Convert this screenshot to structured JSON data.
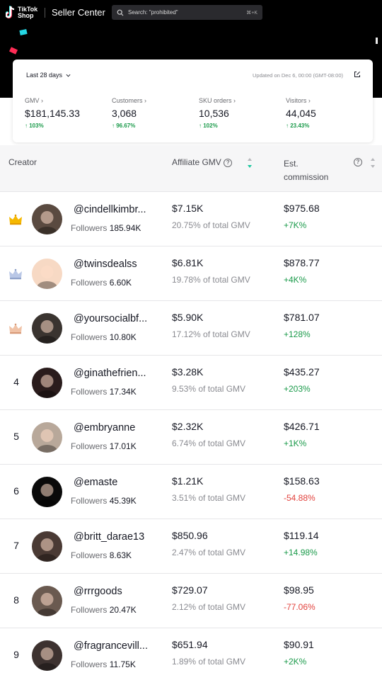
{
  "header": {
    "brand_line1": "TikTok",
    "brand_line2": "Shop",
    "app_title": "Seller Center",
    "search_placeholder": "Search: \"prohibited\"",
    "search_shortcut": "⌘+K"
  },
  "stats": {
    "period": "Last 28 days",
    "updated": "Updated on Dec 6, 00:00 (GMT-08:00)",
    "metrics": [
      {
        "label": "GMV ›",
        "value": "$181,145.33",
        "delta": "103%"
      },
      {
        "label": "Customers ›",
        "value": "3,068",
        "delta": "96.67%"
      },
      {
        "label": "SKU orders ›",
        "value": "10,536",
        "delta": "102%"
      },
      {
        "label": "Visitors ›",
        "value": "44,045",
        "delta": "23.43%"
      }
    ]
  },
  "table": {
    "headers": {
      "creator": "Creator",
      "affiliate_gmv": "Affiliate GMV",
      "est_line1": "Est.",
      "est_line2": "commission"
    },
    "rows": [
      {
        "rank": "",
        "crown": "gold-crown-icon",
        "handle": "@cindellkimbr...",
        "followers_label": "Followers",
        "followers": "185.94K",
        "gmv": "$7.15K",
        "share": "20.75% of total GMV",
        "commission": "$975.68",
        "delta": "+7K%",
        "trend": "pos",
        "avatar_color": "#5a4a40"
      },
      {
        "rank": "",
        "crown": "silver-crown-icon",
        "handle": "@twinsdealss",
        "followers_label": "Followers",
        "followers": "6.60K",
        "gmv": "$6.81K",
        "share": "19.78% of total GMV",
        "commission": "$878.77",
        "delta": "+4K%",
        "trend": "pos",
        "avatar_color": "#f7d9c4"
      },
      {
        "rank": "",
        "crown": "bronze-crown-icon",
        "handle": "@yoursocialbf...",
        "followers_label": "Followers",
        "followers": "10.80K",
        "gmv": "$5.90K",
        "share": "17.12% of total GMV",
        "commission": "$781.07",
        "delta": "+128%",
        "trend": "pos",
        "avatar_color": "#3a3430"
      },
      {
        "rank": "4",
        "crown": "",
        "handle": "@ginathefrien...",
        "followers_label": "Followers",
        "followers": "17.34K",
        "gmv": "$3.28K",
        "share": "9.53% of total GMV",
        "commission": "$435.27",
        "delta": "+203%",
        "trend": "pos",
        "avatar_color": "#2a1c1c"
      },
      {
        "rank": "5",
        "crown": "",
        "handle": "@embryanne",
        "followers_label": "Followers",
        "followers": "17.01K",
        "gmv": "$2.32K",
        "share": "6.74% of total GMV",
        "commission": "$426.71",
        "delta": "+1K%",
        "trend": "pos",
        "avatar_color": "#b8a89a"
      },
      {
        "rank": "6",
        "crown": "",
        "handle": "@emaste",
        "followers_label": "Followers",
        "followers": "45.39K",
        "gmv": "$1.21K",
        "share": "3.51% of total GMV",
        "commission": "$158.63",
        "delta": "-54.88%",
        "trend": "neg",
        "avatar_color": "#0a0a0a"
      },
      {
        "rank": "7",
        "crown": "",
        "handle": "@britt_darae13",
        "followers_label": "Followers",
        "followers": "8.63K",
        "gmv": "$850.96",
        "share": "2.47% of total GMV",
        "commission": "$119.14",
        "delta": "+14.98%",
        "trend": "pos",
        "avatar_color": "#4a3a34"
      },
      {
        "rank": "8",
        "crown": "",
        "handle": "@rrrgoods",
        "followers_label": "Followers",
        "followers": "20.47K",
        "gmv": "$729.07",
        "share": "2.12% of total GMV",
        "commission": "$98.95",
        "delta": "-77.06%",
        "trend": "neg",
        "avatar_color": "#6a5a50"
      },
      {
        "rank": "9",
        "crown": "",
        "handle": "@fragrancevill...",
        "followers_label": "Followers",
        "followers": "11.75K",
        "gmv": "$651.94",
        "share": "1.89% of total GMV",
        "commission": "$90.91",
        "delta": "+2K%",
        "trend": "pos",
        "avatar_color": "#3d3230"
      }
    ]
  },
  "colors": {
    "positive": "#1a9a4a",
    "negative": "#e2423d",
    "header_bg": "#000000",
    "accent": "#1ec8a0"
  }
}
